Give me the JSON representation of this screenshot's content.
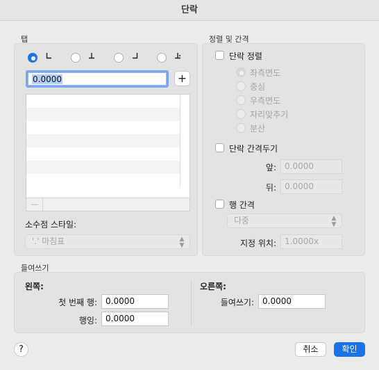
{
  "window": {
    "title": "단락"
  },
  "tabs": {
    "section_label": "탭",
    "stops": [
      {
        "icon": "left-tab-icon",
        "selected": true
      },
      {
        "icon": "center-tab-icon",
        "selected": false
      },
      {
        "icon": "right-tab-icon",
        "selected": false
      },
      {
        "icon": "decimal-tab-icon",
        "selected": false
      }
    ],
    "position_value": "0.0000",
    "add_label": "+",
    "remove_label": "—",
    "decimal_style_label": "소수점 스타일:",
    "decimal_style_value": "'.' 마침표"
  },
  "alignment": {
    "section_label": "정렬 및 간격",
    "paragraph_align_label": "단락 정렬",
    "options": [
      "좌측면도",
      "중심",
      "우측면도",
      "자리맞추기",
      "분산"
    ],
    "selected_option": "좌측면도",
    "paragraph_spacing_label": "단락 간격두기",
    "before_label": "앞:",
    "before_value": "0.0000",
    "after_label": "뒤:",
    "after_value": "0.0000",
    "line_spacing_label": "행 간격",
    "line_spacing_mode": "다중",
    "at_label": "지정 위치:",
    "at_value": "1.0000x"
  },
  "indent": {
    "section_label": "들여쓰기",
    "left_heading": "왼쪽:",
    "first_line_label": "첫 번째 행:",
    "first_line_value": "0.0000",
    "hanging_label": "행잉:",
    "hanging_value": "0.0000",
    "right_heading": "오른쪽:",
    "right_indent_label": "들여쓰기:",
    "right_indent_value": "0.0000"
  },
  "footer": {
    "help_label": "?",
    "cancel_label": "취소",
    "ok_label": "확인"
  },
  "colors": {
    "accent": "#1a73e8",
    "background": "#ececec"
  }
}
